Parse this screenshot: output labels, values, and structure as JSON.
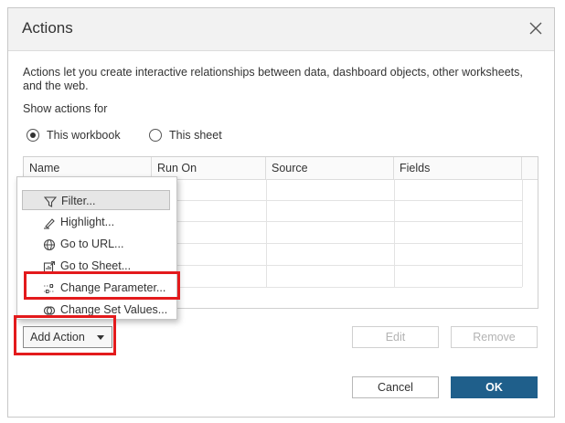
{
  "dialog": {
    "title": "Actions",
    "description": "Actions let you create interactive relationships between data, dashboard objects, other worksheets, and the web.",
    "show_actions_label": "Show actions for",
    "radios": [
      {
        "label": "This workbook",
        "checked": true
      },
      {
        "label": "This sheet",
        "checked": false
      }
    ]
  },
  "table": {
    "columns": [
      "Name",
      "Run On",
      "Source",
      "Fields"
    ]
  },
  "menu": {
    "items": [
      {
        "label": "Filter...",
        "icon": "filter-icon"
      },
      {
        "label": "Highlight...",
        "icon": "highlight-icon"
      },
      {
        "label": "Go to URL...",
        "icon": "globe-icon"
      },
      {
        "label": "Go to Sheet...",
        "icon": "sheet-icon"
      },
      {
        "label": "Change Parameter...",
        "icon": "parameter-icon"
      },
      {
        "label": "Change Set Values...",
        "icon": "set-values-icon"
      }
    ]
  },
  "buttons": {
    "add_action": "Add Action",
    "edit": "Edit",
    "remove": "Remove",
    "cancel": "Cancel",
    "ok": "OK"
  },
  "colors": {
    "primary": "#1f5f8b",
    "highlight_box": "#e31a1c"
  }
}
